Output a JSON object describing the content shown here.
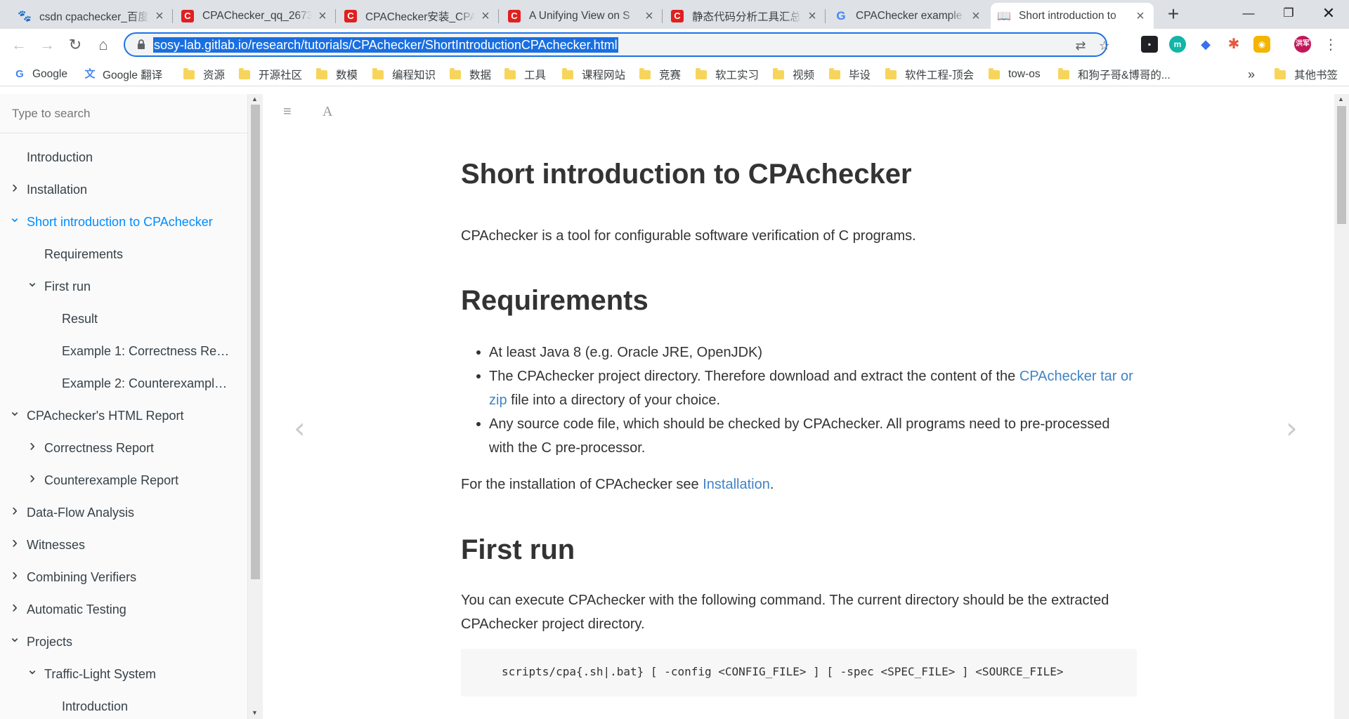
{
  "browser": {
    "tabs": [
      {
        "title": "csdn cpachecker_百度",
        "icon": "paw-icon",
        "color": "#2932e1"
      },
      {
        "title": "CPAChecker_qq_2673",
        "icon": "csdn-icon",
        "color": "#e02020"
      },
      {
        "title": "CPAChecker安装_CPA",
        "icon": "csdn-icon",
        "color": "#e02020"
      },
      {
        "title": "A Unifying View on S",
        "icon": "csdn-icon",
        "color": "#e02020"
      },
      {
        "title": "静态代码分析工具汇总",
        "icon": "csdn-icon",
        "color": "#e02020"
      },
      {
        "title": "CPAChecker example",
        "icon": "google-icon",
        "color": "#4285f4"
      },
      {
        "title": "Short introduction to",
        "icon": "book-icon",
        "color": "#5f6368"
      }
    ],
    "url": "sosy-lab.gitlab.io/research/tutorials/CPAchecker/ShortIntroductionCPAchecker.html",
    "bookmarks": [
      {
        "label": "Google",
        "type": "google"
      },
      {
        "label": "Google 翻译",
        "type": "translate"
      },
      {
        "label": "资源",
        "type": "folder"
      },
      {
        "label": "开源社区",
        "type": "folder"
      },
      {
        "label": "数模",
        "type": "folder"
      },
      {
        "label": "编程知识",
        "type": "folder"
      },
      {
        "label": "数据",
        "type": "folder"
      },
      {
        "label": "工具",
        "type": "folder"
      },
      {
        "label": "课程网站",
        "type": "folder"
      },
      {
        "label": "竞赛",
        "type": "folder"
      },
      {
        "label": "软工实习",
        "type": "folder"
      },
      {
        "label": "视频",
        "type": "folder"
      },
      {
        "label": "毕设",
        "type": "folder"
      },
      {
        "label": "软件工程-顶会",
        "type": "folder"
      },
      {
        "label": "tow-os",
        "type": "folder"
      },
      {
        "label": "和狗子哥&博哥的...",
        "type": "folder"
      }
    ],
    "bookmarks_more": "»",
    "other_bookmarks": "其他书签",
    "profile_label": "洪军"
  },
  "sidebar": {
    "search_placeholder": "Type to search",
    "items": [
      {
        "label": "Introduction",
        "level": 0,
        "chevron": "none"
      },
      {
        "label": "Installation",
        "level": 0,
        "chevron": "right"
      },
      {
        "label": "Short introduction to CPAchecker",
        "level": 0,
        "chevron": "down",
        "active": true
      },
      {
        "label": "Requirements",
        "level": 1,
        "chevron": "none"
      },
      {
        "label": "First run",
        "level": 1,
        "chevron": "down"
      },
      {
        "label": "Result",
        "level": 2,
        "chevron": "none"
      },
      {
        "label": "Example 1: Correctness Re…",
        "level": 2,
        "chevron": "none"
      },
      {
        "label": "Example 2: Counterexample…",
        "level": 2,
        "chevron": "none"
      },
      {
        "label": "CPAchecker's HTML Report",
        "level": 0,
        "chevron": "down"
      },
      {
        "label": "Correctness Report",
        "level": 1,
        "chevron": "right"
      },
      {
        "label": "Counterexample Report",
        "level": 1,
        "chevron": "right"
      },
      {
        "label": "Data-Flow Analysis",
        "level": 0,
        "chevron": "right"
      },
      {
        "label": "Witnesses",
        "level": 0,
        "chevron": "right"
      },
      {
        "label": "Combining Verifiers",
        "level": 0,
        "chevron": "right"
      },
      {
        "label": "Automatic Testing",
        "level": 0,
        "chevron": "right"
      },
      {
        "label": "Projects",
        "level": 0,
        "chevron": "down"
      },
      {
        "label": "Traffic-Light System",
        "level": 1,
        "chevron": "down"
      },
      {
        "label": "Introduction",
        "level": 2,
        "chevron": "none"
      }
    ]
  },
  "content": {
    "title": "Short introduction to CPAchecker",
    "intro": "CPAchecker is a tool for configurable software verification of C programs.",
    "requirements_heading": "Requirements",
    "req1": "At least Java 8 (e.g. Oracle JRE, OpenJDK)",
    "req2_pre": "The CPAchecker project directory. Therefore download and extract the content of the ",
    "req2_link": "CPAchecker tar or zip",
    "req2_post": " file into a directory of your choice.",
    "req3": "Any source code file, which should be checked by CPAchecker. All programs need to pre-processed with the C pre-processor.",
    "install_pre": "For the installation of CPAchecker see ",
    "install_link": "Installation",
    "install_post": ".",
    "first_run_heading": "First run",
    "first_run_text": "You can execute CPAchecker with the following command. The current directory should be the extracted CPAchecker project directory.",
    "command": "scripts/cpa{.sh|.bat} [ -config <CONFIG_FILE> ] [ -spec <SPEC_FILE> ] <SOURCE_FILE>"
  }
}
